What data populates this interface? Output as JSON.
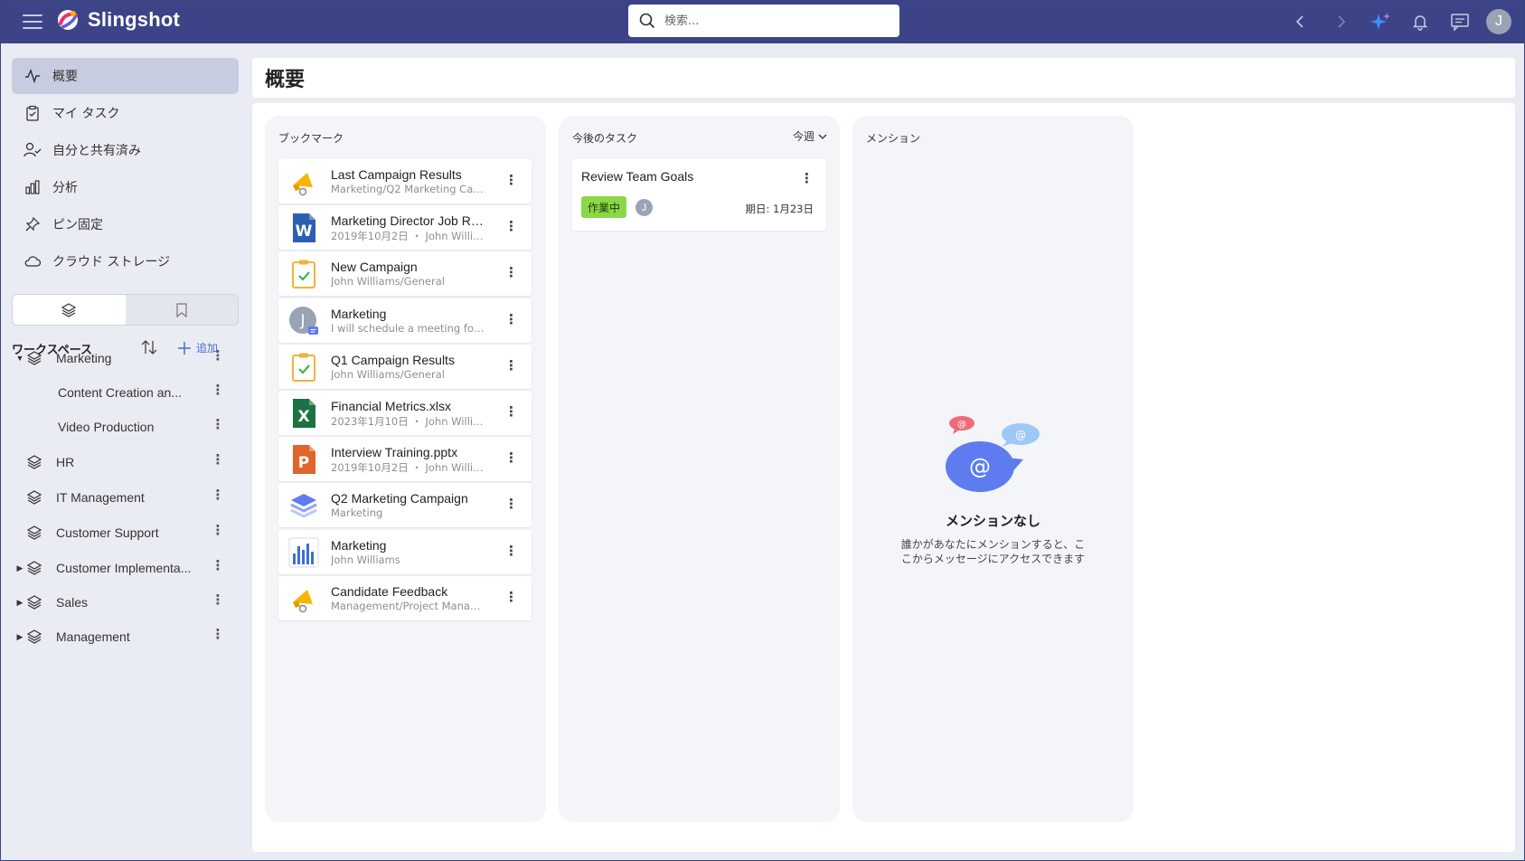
{
  "app": {
    "name": "Slingshot",
    "user_initial": "J"
  },
  "search": {
    "placeholder": "検索..."
  },
  "sidebar": {
    "nav": [
      {
        "label": "概要",
        "icon": "activity-icon"
      },
      {
        "label": "マイ タスク",
        "icon": "task-clipboard-icon"
      },
      {
        "label": "自分と共有済み",
        "icon": "shared-user-icon"
      },
      {
        "label": "分析",
        "icon": "bar-chart-icon"
      },
      {
        "label": "ピン固定",
        "icon": "pin-icon"
      },
      {
        "label": "クラウド ストレージ",
        "icon": "cloud-icon"
      }
    ],
    "workspace_title": "ワークスペース",
    "add_label": "追加",
    "workspaces": [
      {
        "label": "Marketing"
      },
      {
        "label": "Content Creation an..."
      },
      {
        "label": "Video Production"
      },
      {
        "label": "HR"
      },
      {
        "label": "IT Management"
      },
      {
        "label": "Customer Support"
      },
      {
        "label": "Customer Implementa..."
      },
      {
        "label": "Sales"
      },
      {
        "label": "Management"
      }
    ]
  },
  "main": {
    "title": "概要",
    "bookmarks": {
      "title": "ブックマーク",
      "items": [
        {
          "title": "Last Campaign Results",
          "subtitle": "Marketing/Q2 Marketing Cam...",
          "icon": "megaphone-icon"
        },
        {
          "title": "Marketing Director Job Ro...",
          "subtitle": "2019年10月2日 ・ John Willia...",
          "icon": "word-file-icon",
          "icon_letter": "W",
          "icon_color": "#2b5fb4"
        },
        {
          "title": "New Campaign",
          "subtitle": "John Williams/General",
          "icon": "task-clipboard-icon"
        },
        {
          "title": "Marketing",
          "subtitle": "I will schedule a meeting for to...",
          "icon": "chat-avatar-icon",
          "icon_letter": "J"
        },
        {
          "title": "Q1 Campaign Results",
          "subtitle": "John Williams/General",
          "icon": "task-clipboard-icon"
        },
        {
          "title": "Financial Metrics.xlsx",
          "subtitle": "2023年1月10日 ・ John Willia...",
          "icon": "excel-file-icon",
          "icon_letter": "X",
          "icon_color": "#1e7145"
        },
        {
          "title": "Interview Training.pptx",
          "subtitle": "2019年10月2日 ・ John Willia...",
          "icon": "powerpoint-file-icon",
          "icon_letter": "P",
          "icon_color": "#e0642c"
        },
        {
          "title": "Q2 Marketing Campaign",
          "subtitle": "Marketing",
          "icon": "layers-project-icon"
        },
        {
          "title": "Marketing",
          "subtitle": "John Williams",
          "icon": "dashboard-chart-icon"
        },
        {
          "title": "Candidate Feedback",
          "subtitle": "Management/Project Manager",
          "icon": "megaphone-icon"
        }
      ]
    },
    "tasks": {
      "title": "今後のタスク",
      "filter": "今週",
      "items": [
        {
          "title": "Review Team Goals",
          "status": "作業中",
          "status_color": "#8bd847",
          "assignee": "J",
          "due": "期日: 1月23日"
        }
      ]
    },
    "mentions": {
      "title": "メンション",
      "empty_title": "メンションなし",
      "empty_desc": "誰かがあなたにメンションすると、ここからメッセージにアクセスできます"
    }
  }
}
